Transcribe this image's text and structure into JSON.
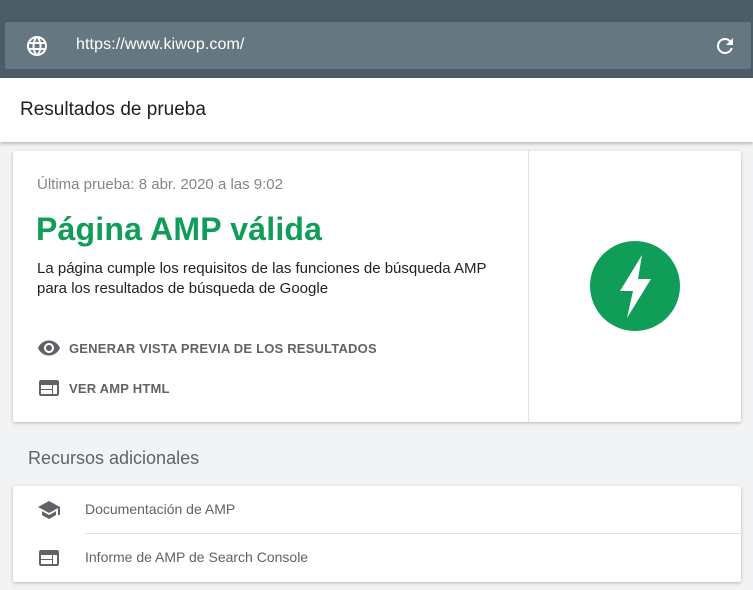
{
  "browser": {
    "url": "https://www.kiwop.com/",
    "globe_icon": "globe-icon",
    "refresh_icon": "refresh-icon",
    "bar_color": "#4b5c66"
  },
  "header": {
    "title": "Resultados de prueba"
  },
  "result_card": {
    "last_test": "Última prueba: 8 abr. 2020 a las 9:02",
    "status_title": "Página AMP válida",
    "status_color": "#0f9d58",
    "description": "La página cumple los requisitos de las funciones de búsqueda AMP para los resultados de búsqueda de Google",
    "actions": [
      {
        "label": "GENERAR VISTA PREVIA DE LOS RESULTADOS",
        "icon": "eye-icon"
      },
      {
        "label": "VER AMP HTML",
        "icon": "web-page-icon"
      }
    ],
    "logo_icon": "amp-lightning-icon"
  },
  "resources": {
    "title": "Recursos adicionales",
    "items": [
      {
        "label": "Documentación de AMP",
        "icon": "school-icon"
      },
      {
        "label": "Informe de AMP de Search Console",
        "icon": "web-page-icon"
      }
    ]
  }
}
